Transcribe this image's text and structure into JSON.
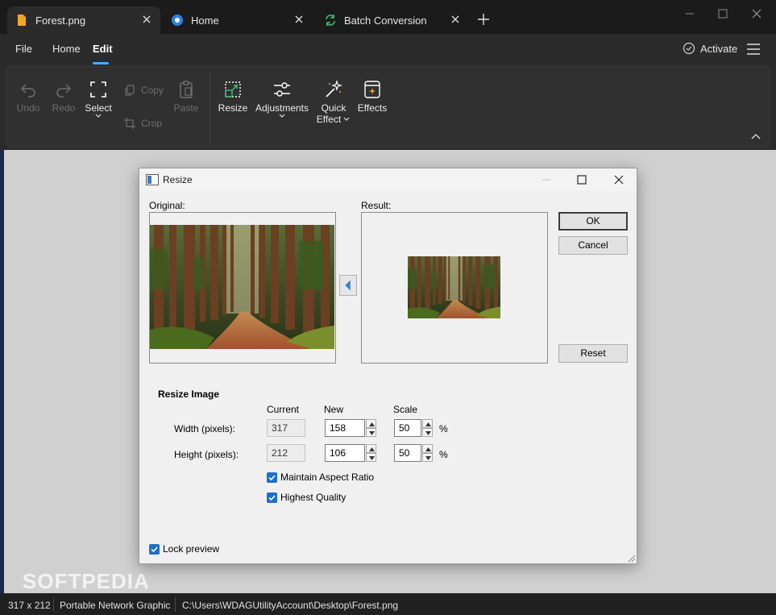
{
  "tabs": [
    {
      "label": "Forest.png",
      "active": true
    },
    {
      "label": "Home",
      "active": false
    },
    {
      "label": "Batch Conversion",
      "active": false
    }
  ],
  "menu": {
    "file": "File",
    "home": "Home",
    "edit": "Edit",
    "activate": "Activate"
  },
  "ribbon": {
    "undo": "Undo",
    "redo": "Redo",
    "select": "Select",
    "copy": "Copy",
    "crop": "Crop",
    "paste": "Paste",
    "resize": "Resize",
    "adjustments": "Adjustments",
    "quick_effect_1": "Quick",
    "quick_effect_2": "Effect",
    "effects": "Effects"
  },
  "dialog": {
    "title": "Resize",
    "original_label": "Original:",
    "result_label": "Result:",
    "ok": "OK",
    "cancel": "Cancel",
    "reset": "Reset",
    "section_title": "Resize Image",
    "col_current": "Current",
    "col_new": "New",
    "col_scale": "Scale",
    "width_label": "Width (pixels):",
    "height_label": "Height (pixels):",
    "width_current": "317",
    "width_new": "158",
    "width_scale": "50",
    "height_current": "212",
    "height_new": "106",
    "height_scale": "50",
    "percent": "%",
    "maintain_aspect": "Maintain Aspect Ratio",
    "highest_quality": "Highest Quality",
    "lock_preview": "Lock preview"
  },
  "status": {
    "dimensions": "317 x 212",
    "format": "Portable Network Graphic",
    "path": "C:\\Users\\WDAGUtilityAccount\\Desktop\\Forest.png"
  },
  "watermark": "SOFTPEDIA",
  "colors": {
    "accent": "#4aa8ff",
    "checkbox": "#1f6fc8",
    "tab_active": "#2b2b2b",
    "canvas": "#d0d0d0"
  }
}
